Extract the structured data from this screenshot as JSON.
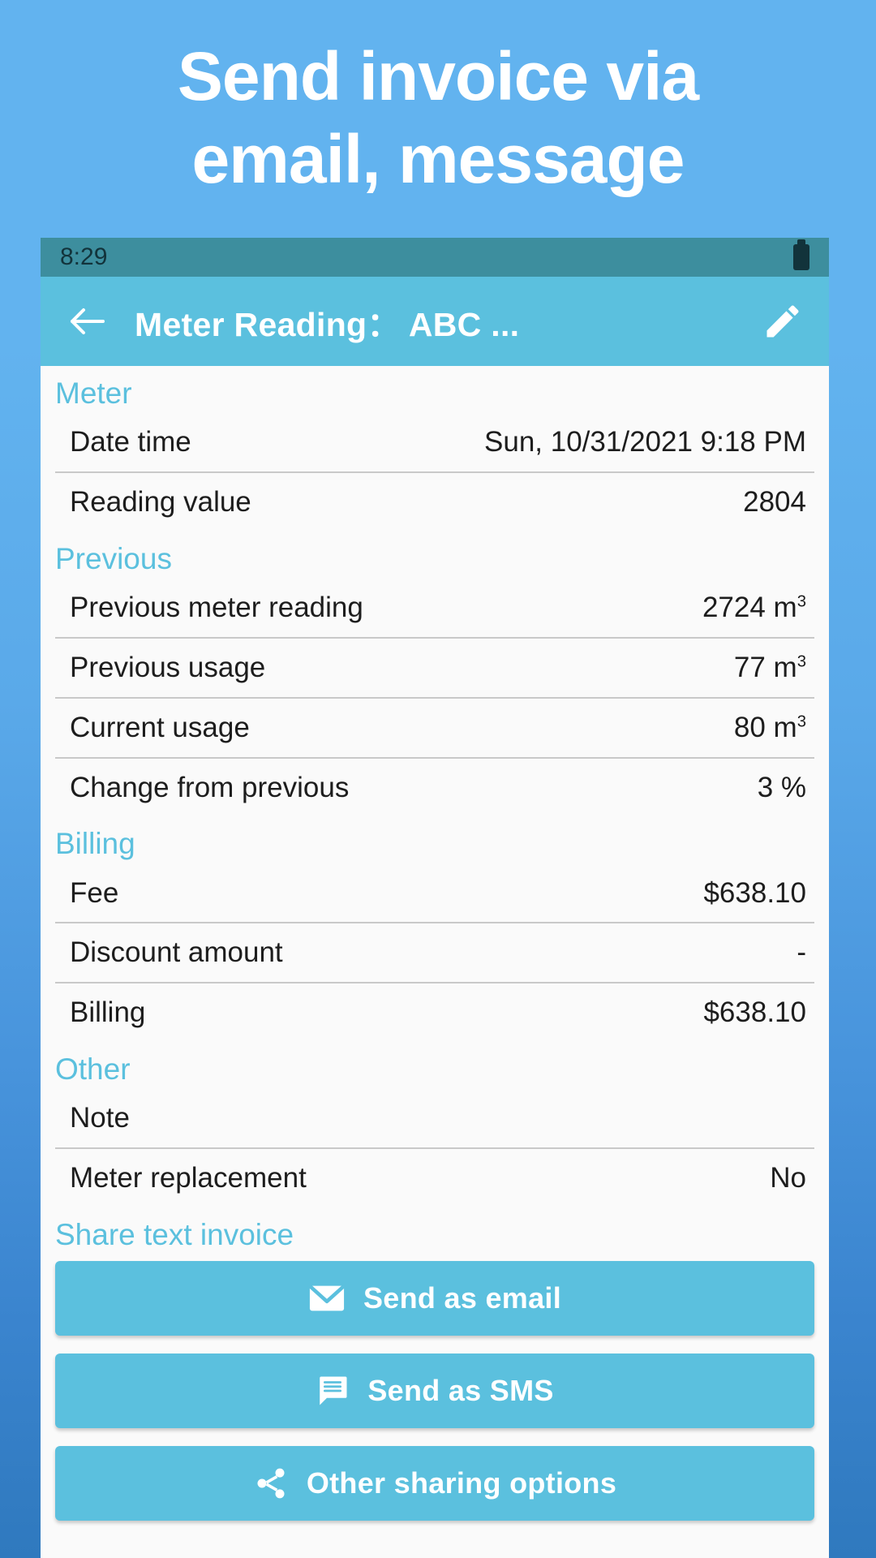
{
  "promo": {
    "line1": "Send invoice via",
    "line2": "email, message"
  },
  "colors": {
    "background_top": "#62b3ef",
    "background_bottom": "#2f79be",
    "appbar": "#5bc0de",
    "statusbar": "#3d8e9e",
    "accent": "#5bc0de",
    "content_bg": "#fafafa",
    "text": "#1d1d1d",
    "divider": "#c9c9c9",
    "button_text": "#ffffff"
  },
  "statusbar": {
    "time": "8:29",
    "battery_icon": "battery-full-icon"
  },
  "appbar": {
    "back_icon": "arrow-left-icon",
    "title": "Meter Reading： ABC ...",
    "edit_icon": "pencil-icon"
  },
  "sections": [
    {
      "id": "meter",
      "header": "Meter",
      "rows": [
        {
          "label": "Date time",
          "value": "Sun, 10/31/2021 9:18 PM",
          "unit": ""
        },
        {
          "label": "Reading value",
          "value": "2804",
          "unit": ""
        }
      ]
    },
    {
      "id": "previous",
      "header": "Previous",
      "rows": [
        {
          "label": "Previous meter reading",
          "value": "2724",
          "unit": "m3"
        },
        {
          "label": "Previous usage",
          "value": "77",
          "unit": "m3"
        },
        {
          "label": "Current usage",
          "value": "80",
          "unit": "m3"
        },
        {
          "label": "Change from previous",
          "value": "3 %",
          "unit": ""
        }
      ]
    },
    {
      "id": "billing",
      "header": "Billing",
      "rows": [
        {
          "label": "Fee",
          "value": "$638.10",
          "unit": ""
        },
        {
          "label": "Discount amount",
          "value": "-",
          "unit": ""
        },
        {
          "label": "Billing",
          "value": "$638.10",
          "unit": ""
        }
      ]
    },
    {
      "id": "other",
      "header": "Other",
      "rows": [
        {
          "label": "Note",
          "value": "",
          "unit": ""
        },
        {
          "label": "Meter replacement",
          "value": "No",
          "unit": ""
        }
      ]
    }
  ],
  "share": {
    "header": "Share text invoice",
    "buttons": [
      {
        "label": "Send as email",
        "icon": "envelope-icon"
      },
      {
        "label": "Send as SMS",
        "icon": "message-icon"
      },
      {
        "label": "Other sharing options",
        "icon": "share-icon"
      }
    ]
  }
}
